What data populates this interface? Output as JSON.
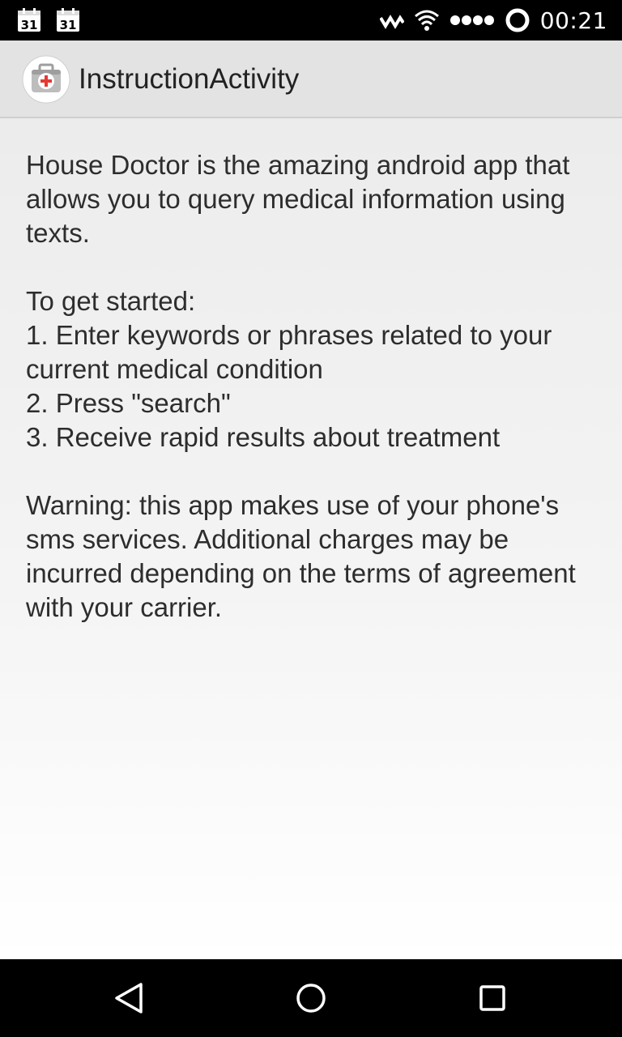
{
  "status_bar": {
    "calendar_icons": [
      "31",
      "31"
    ],
    "icons": [
      "calendar-icon",
      "calendar-icon",
      "signal-strength-icon",
      "wifi-icon",
      "dots-icon",
      "sync-ring-icon"
    ],
    "time": "00:21"
  },
  "action_bar": {
    "app_icon": "medical-kit-icon",
    "title": "InstructionActivity"
  },
  "content": {
    "intro": "House Doctor is the amazing android app that allows you to query medical information using texts.",
    "steps_heading": "To get started:",
    "steps": [
      "1. Enter keywords or phrases related to your current medical condition",
      "2. Press \"search\"",
      "3. Receive rapid results about treatment"
    ],
    "warning": "Warning: this app makes use of your phone's sms services. Additional charges may be incurred depending on the terms of agreement with your carrier."
  },
  "nav_bar": {
    "icons": [
      "back-icon",
      "home-icon",
      "recent-apps-icon"
    ]
  },
  "colors": {
    "status_bar": "#000000",
    "action_bar": "#e3e3e3",
    "text": "#2d2d2d",
    "app_icon_cross": "#e53935"
  }
}
